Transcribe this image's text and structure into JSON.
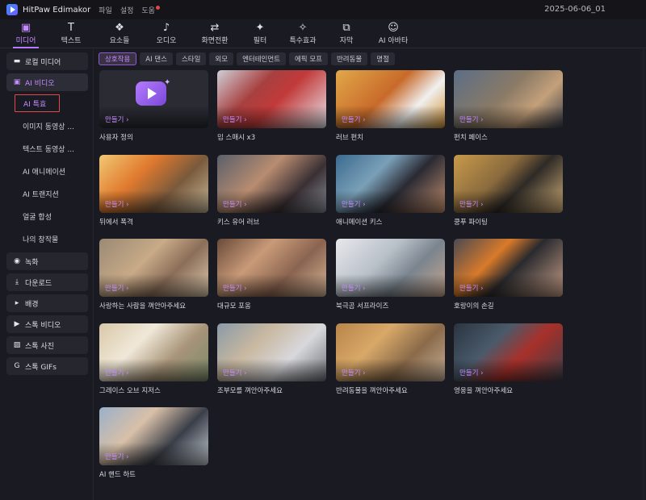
{
  "titlebar": {
    "app_name": "HitPaw Edimakor",
    "menus": [
      "파일",
      "설정",
      "도움"
    ],
    "project_name": "2025-06-06_01"
  },
  "toolbar": {
    "tools": [
      {
        "label": "미디어",
        "icon": "media-icon",
        "glyph": "▣",
        "active": true
      },
      {
        "label": "텍스트",
        "icon": "text-icon",
        "glyph": "T",
        "active": false
      },
      {
        "label": "요소들",
        "icon": "elements-icon",
        "glyph": "❖",
        "active": false
      },
      {
        "label": "오디오",
        "icon": "music-note-icon",
        "glyph": "♪",
        "active": false
      },
      {
        "label": "화면전환",
        "icon": "transition-icon",
        "glyph": "⇄",
        "active": false
      },
      {
        "label": "필터",
        "icon": "filter-icon",
        "glyph": "✦",
        "active": false
      },
      {
        "label": "특수효과",
        "icon": "effects-icon",
        "glyph": "✧",
        "active": false
      },
      {
        "label": "자막",
        "icon": "subtitle-icon",
        "glyph": "⧉",
        "active": false
      },
      {
        "label": "AI 아바타",
        "icon": "avatar-icon",
        "glyph": "☺",
        "active": false
      }
    ]
  },
  "sidebar": {
    "local_media": "로컬 미디어",
    "ai_video": "AI 비디오",
    "ai_sub": [
      "AI 특효",
      "이미지 동영상 ...",
      "텍스트 동영상 ...",
      "AI 애니메이션",
      "AI 트랜지션",
      "얼굴 합성",
      "나의 창작물"
    ],
    "bottom": [
      {
        "label": "녹화",
        "icon": "record-icon",
        "glyph": "◉"
      },
      {
        "label": "다운로드",
        "icon": "download-icon",
        "glyph": "⤓"
      },
      {
        "label": "배경",
        "icon": "triangle-right-icon",
        "glyph": "▸"
      },
      {
        "label": "스톡 비디오",
        "icon": "play-circle-icon",
        "glyph": "▶"
      },
      {
        "label": "스톡 사진",
        "icon": "image-icon",
        "glyph": "▨"
      },
      {
        "label": "스톡 GIFs",
        "icon": "gif-icon",
        "glyph": "G"
      }
    ]
  },
  "chips": [
    "상호작용",
    "AI 댄스",
    "스타일",
    "외모",
    "엔터테인먼트",
    "에픽 모프",
    "반려동물",
    "명절"
  ],
  "make_label": "만들기  ›",
  "cards": [
    {
      "caption": "사용자 정의",
      "bg": "custom"
    },
    {
      "caption": "밈 스매시 x3",
      "bg": "linear-gradient(135deg,#cfcfd6 0%,#a84040 35%,#c23a3a 55%,#e8e8ee 100%)"
    },
    {
      "caption": "러브 펀치",
      "bg": "linear-gradient(135deg,#e2a84a 0%,#c86a2a 45%,#f0f0f0 70%,#d0902e 100%)"
    },
    {
      "caption": "펀치 페이스",
      "bg": "linear-gradient(135deg,#5b6e86 0%,#8a7a66 45%,#c4a07a 70%,#3a3f4a 100%)"
    },
    {
      "caption": "뒤에서 폭격",
      "bg": "linear-gradient(135deg,#f2c873 0%,#e07a2e 35%,#7a5a3c 65%,#c8b89a 100%)"
    },
    {
      "caption": "키스 유어 러브",
      "bg": "linear-gradient(135deg,#5a5f6a 0%,#b88c70 40%,#3a3034 70%,#8a8f98 100%)"
    },
    {
      "caption": "애니메이션 키스",
      "bg": "linear-gradient(135deg,#3b6a8e 0%,#7aa0b8 35%,#2a2a33 60%,#c49070 100%)"
    },
    {
      "caption": "쿵푸 파이팅",
      "bg": "linear-gradient(135deg,#c89a4a 0%,#8a6a3e 40%,#2e2a26 60%,#d2b07a 100%)"
    },
    {
      "caption": "사랑하는 사람을 껴안아주세요",
      "bg": "linear-gradient(135deg,#9a8a74 0%,#c8aa88 40%,#8a6e58 65%,#e0cbb0 100%)"
    },
    {
      "caption": "대규모 포옹",
      "bg": "linear-gradient(135deg,#6a4a3a 0%,#c89a78 35%,#8a6450 65%,#d8b898 100%)"
    },
    {
      "caption": "북극곰 서프라이즈",
      "bg": "linear-gradient(135deg,#e8e8ec 0%,#b8c0c8 40%,#7a848e 65%,#c8a890 100%)"
    },
    {
      "caption": "호랑이의 손길",
      "bg": "linear-gradient(135deg,#4a4a52 0%,#d87a2a 35%,#2a2a2e 55%,#c8a088 100%)"
    },
    {
      "caption": "그레이스 오브 지저스",
      "bg": "linear-gradient(135deg,#d8c8a8 0%,#f0e8d8 35%,#a89478 65%,#7a8a6a 100%)"
    },
    {
      "caption": "조부모를 껴안아주세요",
      "bg": "linear-gradient(135deg,#8a9aa8 0%,#c8b8a0 35%,#d8d8dc 65%,#6a6e74 100%)"
    },
    {
      "caption": "반려동물을 껴안아주세요",
      "bg": "linear-gradient(135deg,#b8844a 0%,#d8a868 35%,#8a6a4a 65%,#c8b098 100%)"
    },
    {
      "caption": "영웅을 껴안아주세요",
      "bg": "linear-gradient(135deg,#2a3440 0%,#4a5a6a 35%,#a8302a 60%,#3a3e48 100%)"
    },
    {
      "caption": "AI 핸드 하트",
      "bg": "linear-gradient(135deg,#9ab0c8 0%,#d8c0a8 35%,#3a3e48 65%,#c8d0d8 100%)"
    }
  ]
}
